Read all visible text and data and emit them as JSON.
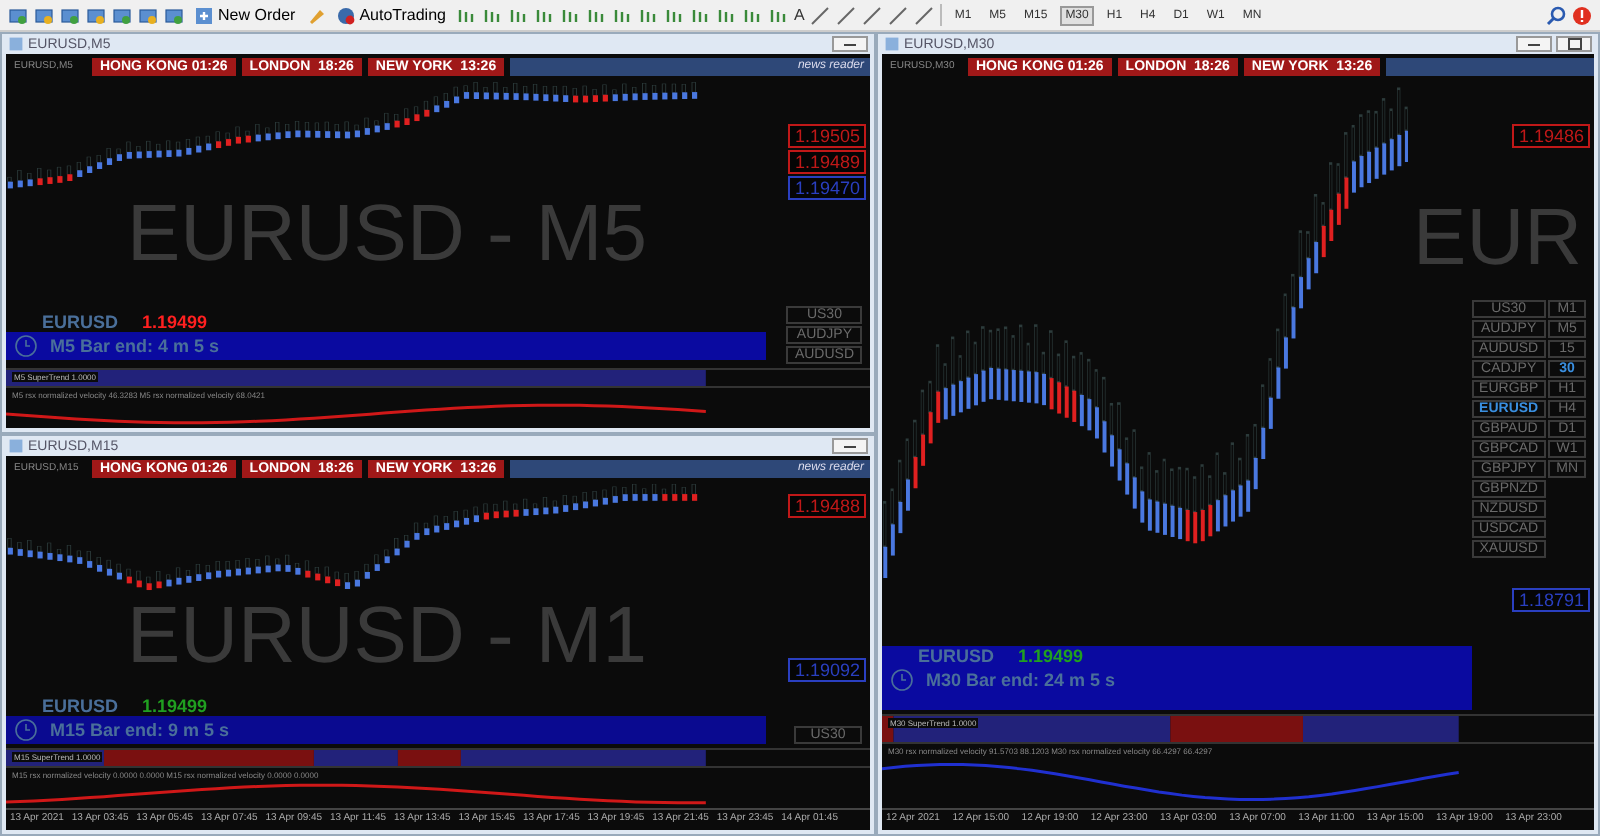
{
  "toolbar": {
    "buttons": [
      {
        "label": "New Order"
      },
      {
        "label": "AutoTrading"
      }
    ],
    "text_tool": "A",
    "timeframes": [
      {
        "label": "M1",
        "selected": false
      },
      {
        "label": "M5",
        "selected": false
      },
      {
        "label": "M15",
        "selected": false
      },
      {
        "label": "M30",
        "selected": true
      },
      {
        "label": "H1",
        "selected": false
      },
      {
        "label": "H4",
        "selected": false
      },
      {
        "label": "D1",
        "selected": false
      },
      {
        "label": "W1",
        "selected": false
      },
      {
        "label": "MN",
        "selected": false
      }
    ]
  },
  "windows": [
    {
      "title": "EURUSD,M5",
      "chart_label": "EURUSD,M5",
      "sessions": [
        "HONG KONG 01:26",
        "LONDON  18:26",
        "NEW YORK  13:26"
      ],
      "news_reader": "news reader",
      "watermark": "EURUSD - M5",
      "price_labels": [
        {
          "text": "1.19505",
          "color": "#c01818"
        },
        {
          "text": "1.19489",
          "color": "#c01818"
        },
        {
          "text": "1.19470",
          "color": "#2a3fc0"
        }
      ],
      "symbol_line": {
        "symbol": "EURUSD",
        "price": "1.19499",
        "color": "#ff2020"
      },
      "bar_end": "M5 Bar end: 4 m 5 s",
      "symbols": [
        {
          "label": "US30",
          "selected": false
        },
        {
          "label": "AUDJPY",
          "selected": false
        },
        {
          "label": "AUDUSD",
          "selected": false
        }
      ],
      "supertrend": "M5 SuperTrend 1.0000",
      "velocity": "M5 rsx normalized velocity 46.3283  M5 rsx normalized velocity 68.0421"
    },
    {
      "title": "EURUSD,M15",
      "chart_label": "EURUSD,M15",
      "sessions": [
        "HONG KONG 01:26",
        "LONDON  18:26",
        "NEW YORK  13:26"
      ],
      "news_reader": "news reader",
      "watermark": "EURUSD - M1",
      "price_labels": [
        {
          "text": "1.19488",
          "color": "#c01818"
        },
        {
          "text": "1.19092",
          "color": "#2a3fc0"
        }
      ],
      "symbol_line": {
        "symbol": "EURUSD",
        "price": "1.19499",
        "color": "#20a020"
      },
      "bar_end": "M15 Bar end: 9 m 5 s",
      "symbols": [
        {
          "label": "US30",
          "selected": false
        }
      ],
      "supertrend": "M15 SuperTrend 1.0000",
      "velocity": "M15 rsx normalized velocity 0.0000 0.0000  M15 rsx normalized velocity 0.0000 0.0000",
      "time_axis": [
        "13 Apr 2021",
        "13 Apr 03:45",
        "13 Apr 05:45",
        "13 Apr 07:45",
        "13 Apr 09:45",
        "13 Apr 11:45",
        "13 Apr 13:45",
        "13 Apr 15:45",
        "13 Apr 17:45",
        "13 Apr 19:45",
        "13 Apr 21:45",
        "13 Apr 23:45",
        "14 Apr 01:45"
      ]
    },
    {
      "title": "EURUSD,M30",
      "chart_label": "EURUSD,M30",
      "sessions": [
        "HONG KONG 01:26",
        "LONDON  18:26",
        "NEW YORK  13:26"
      ],
      "watermark": "EUR",
      "price_labels": [
        {
          "text": "1.19486",
          "color": "#c01818"
        },
        {
          "text": "1.18791",
          "color": "#2a3fc0"
        }
      ],
      "symbol_line": {
        "symbol": "EURUSD",
        "price": "1.19499",
        "color": "#20a020"
      },
      "bar_end": "M30 Bar end: 24 m 5 s",
      "symbols": [
        {
          "label": "US30",
          "selected": false
        },
        {
          "label": "AUDJPY",
          "selected": false
        },
        {
          "label": "AUDUSD",
          "selected": false
        },
        {
          "label": "CADJPY",
          "selected": false
        },
        {
          "label": "EURGBP",
          "selected": false
        },
        {
          "label": "EURUSD",
          "selected": true
        },
        {
          "label": "GBPAUD",
          "selected": false
        },
        {
          "label": "GBPCAD",
          "selected": false
        },
        {
          "label": "GBPJPY",
          "selected": false
        },
        {
          "label": "GBPNZD",
          "selected": false
        },
        {
          "label": "NZDUSD",
          "selected": false
        },
        {
          "label": "USDCAD",
          "selected": false
        },
        {
          "label": "XAUUSD",
          "selected": false
        }
      ],
      "timeframes": [
        {
          "label": "M1",
          "selected": false
        },
        {
          "label": "M5",
          "selected": false
        },
        {
          "label": "15",
          "selected": false
        },
        {
          "label": "30",
          "selected": true
        },
        {
          "label": "H1",
          "selected": false
        },
        {
          "label": "H4",
          "selected": false
        },
        {
          "label": "D1",
          "selected": false
        },
        {
          "label": "W1",
          "selected": false
        },
        {
          "label": "MN",
          "selected": false
        }
      ],
      "supertrend": "M30 SuperTrend 1.0000",
      "velocity": "M30 rsx normalized velocity 91.5703 88.1203  M30 rsx normalized velocity 66.4297 66.4297",
      "time_axis": [
        "12 Apr 2021",
        "12 Apr 15:00",
        "12 Apr 19:00",
        "12 Apr 23:00",
        "13 Apr 03:00",
        "13 Apr 07:00",
        "13 Apr 11:00",
        "13 Apr 15:00",
        "13 Apr 19:00",
        "13 Apr 23:00"
      ]
    }
  ]
}
